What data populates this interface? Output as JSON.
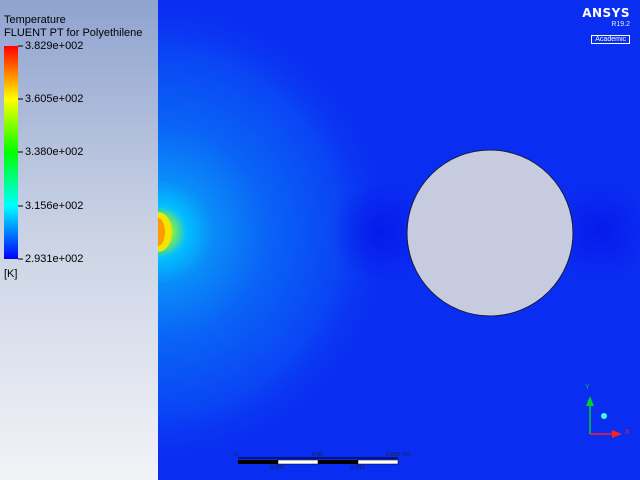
{
  "legend": {
    "title": "Temperature",
    "subtitle": "FLUENT PT for Polyethilene",
    "labels": [
      "3.829e+002",
      "3.605e+002",
      "3.380e+002",
      "3.156e+002",
      "2.931e+002"
    ],
    "unit": "[K]",
    "colors": [
      "#ff0000",
      "#ffff00",
      "#00ff00",
      "#00ffff",
      "#0000ff"
    ]
  },
  "brand": {
    "name": "ANSYS",
    "version": "R19.2",
    "edition": "Academic"
  },
  "scale_bar": {
    "labels": [
      "0",
      "0.00",
      "0.010 (m)",
      "0.005",
      "0.015"
    ]
  },
  "triad": {
    "axes": [
      "Y",
      "X"
    ]
  },
  "colors": {
    "field_background": "#0a2df2",
    "cylinder_fill": "#c6cbe0",
    "hot_spot": "#ffe600"
  }
}
